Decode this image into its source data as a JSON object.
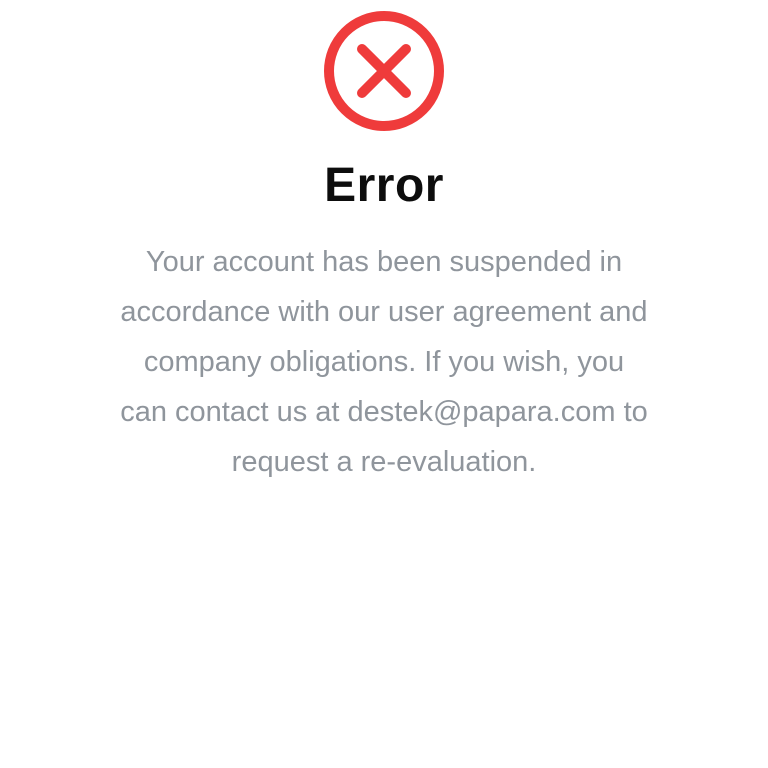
{
  "dialog": {
    "icon": "error-x-circle-icon",
    "accent_color": "#ef3b3b",
    "title": "Error",
    "message_lines": [
      "Your account has been suspended in",
      "accordance with our user agreement and",
      "company obligations. If you wish, you",
      "can contact us at destek@papara.com to",
      "request a re-evaluation."
    ]
  }
}
